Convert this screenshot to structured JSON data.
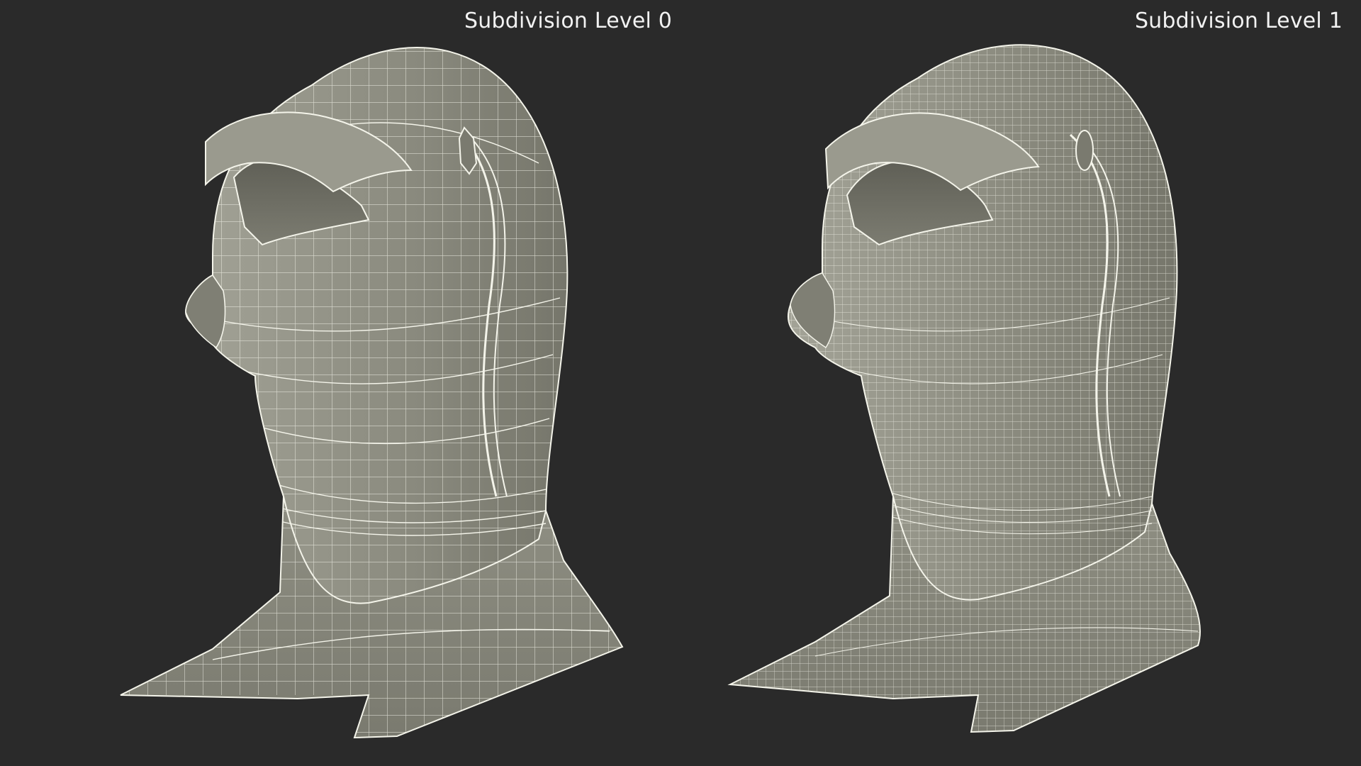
{
  "viewports": [
    {
      "label": "Subdivision Level 0",
      "wire_density": 1
    },
    {
      "label": "Subdivision Level 1",
      "wire_density": 2
    }
  ],
  "colors": {
    "background": "#2a2a2a",
    "surface": "#8c8c80",
    "surface_shadow": "#6f6f64",
    "surface_highlight": "#a3a397",
    "wire": "#f4f4ea",
    "label": "#f2f2f2"
  }
}
